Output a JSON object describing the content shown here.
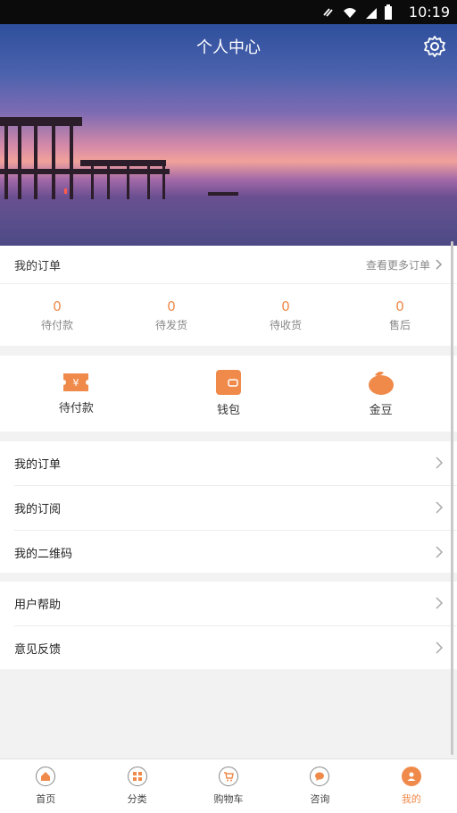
{
  "status": {
    "time": "10:19"
  },
  "header": {
    "title": "个人中心"
  },
  "orders": {
    "title": "我的订单",
    "more": "查看更多订单",
    "stats": [
      {
        "num": "0",
        "label": "待付款"
      },
      {
        "num": "0",
        "label": "待发货"
      },
      {
        "num": "0",
        "label": "待收货"
      },
      {
        "num": "0",
        "label": "售后"
      }
    ]
  },
  "quick": [
    {
      "label": "待付款",
      "icon": "ticket-icon"
    },
    {
      "label": "钱包",
      "icon": "wallet-icon"
    },
    {
      "label": "金豆",
      "icon": "bean-icon"
    }
  ],
  "menu1": [
    {
      "label": "我的订单"
    },
    {
      "label": "我的订阅"
    },
    {
      "label": "我的二维码"
    }
  ],
  "menu2": [
    {
      "label": "用户帮助"
    },
    {
      "label": "意见反馈"
    }
  ],
  "tabs": [
    {
      "label": "首页",
      "icon": "home-icon"
    },
    {
      "label": "分类",
      "icon": "grid-icon"
    },
    {
      "label": "购物车",
      "icon": "cart-icon"
    },
    {
      "label": "咨询",
      "icon": "chat-icon"
    },
    {
      "label": "我的",
      "icon": "user-icon",
      "active": true
    }
  ],
  "colors": {
    "accent": "#f08a4b"
  }
}
